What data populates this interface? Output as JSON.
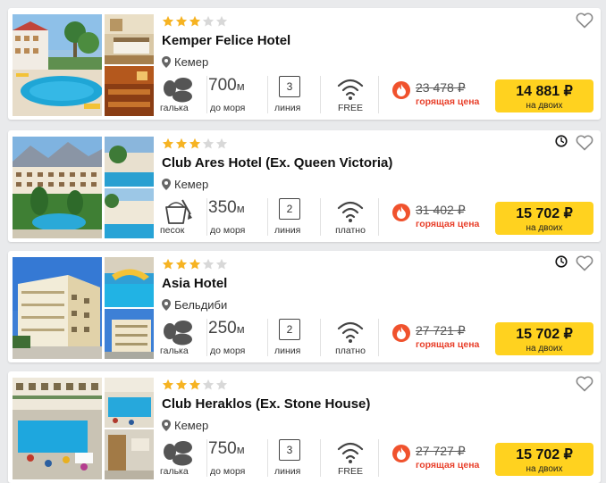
{
  "colors": {
    "accent": "#ffd21f",
    "hot": "#e8402b",
    "star_filled": "#f6b322",
    "star_empty": "#d8d8d8"
  },
  "hotels": [
    {
      "stars": 3,
      "name": "Kemper Felice Hotel",
      "location": "Кемер",
      "beach_type": "галька",
      "beach_icon": "pebbles-icon",
      "distance_value": "700",
      "distance_unit": "м",
      "distance_label": "до моря",
      "line_number": "3",
      "line_label": "линия",
      "wifi_label": "FREE",
      "old_price": "23 478 ₽",
      "hot_label": "горящая цена",
      "price": "14 881 ₽",
      "price_sub": "на двоих",
      "has_clock": false
    },
    {
      "stars": 3,
      "name": "Club Ares Hotel (Ex. Queen Victoria)",
      "location": "Кемер",
      "beach_type": "песок",
      "beach_icon": "sand-bucket-icon",
      "distance_value": "350",
      "distance_unit": "м",
      "distance_label": "до моря",
      "line_number": "2",
      "line_label": "линия",
      "wifi_label": "платно",
      "old_price": "31 402 ₽",
      "hot_label": "горящая цена",
      "price": "15 702 ₽",
      "price_sub": "на двоих",
      "has_clock": true
    },
    {
      "stars": 3,
      "name": "Asia Hotel",
      "location": "Бельдиби",
      "beach_type": "галька",
      "beach_icon": "pebbles-icon",
      "distance_value": "250",
      "distance_unit": "м",
      "distance_label": "до моря",
      "line_number": "2",
      "line_label": "линия",
      "wifi_label": "платно",
      "old_price": "27 721 ₽",
      "hot_label": "горящая цена",
      "price": "15 702 ₽",
      "price_sub": "на двоих",
      "has_clock": true
    },
    {
      "stars": 3,
      "name": "Club Heraklos (Ex. Stone House)",
      "location": "Кемер",
      "beach_type": "галька",
      "beach_icon": "pebbles-icon",
      "distance_value": "750",
      "distance_unit": "м",
      "distance_label": "до моря",
      "line_number": "3",
      "line_label": "линия",
      "wifi_label": "FREE",
      "old_price": "27 727 ₽",
      "hot_label": "горящая цена",
      "price": "15 702 ₽",
      "price_sub": "на двоих",
      "has_clock": false
    }
  ]
}
